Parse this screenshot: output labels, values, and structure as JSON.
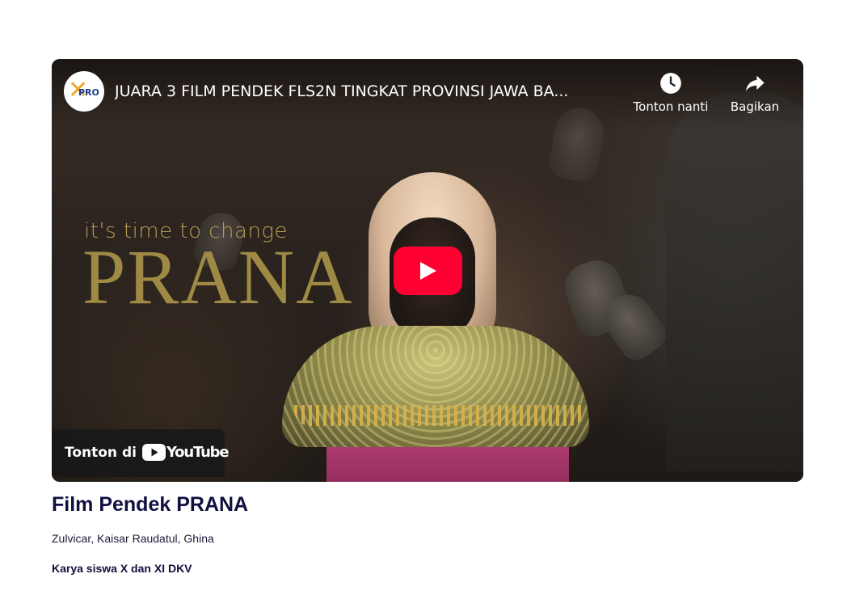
{
  "video_embed": {
    "title": "JUARA 3 FILM PENDEK FLS2N TINGKAT PROVINSI JAWA BA...",
    "channel_avatar_text": "PRO",
    "watch_later_label": "Tonton nanti",
    "share_label": "Bagikan",
    "watch_on_label": "Tonton di",
    "youtube_wordmark": "YouTube",
    "thumbnail": {
      "tagline": "it's time to change",
      "title": "PRANA"
    },
    "play_button_color": "#ff0033",
    "icons": {
      "watch_later": "clock-icon",
      "share": "share-arrow-icon",
      "play": "play-icon",
      "youtube": "youtube-logo-icon"
    }
  },
  "article": {
    "title": "Film Pendek PRANA",
    "credits": "Zulvicar, Kaisar Raudatul, Ghina",
    "subtitle": "Karya siswa X dan XI DKV"
  }
}
